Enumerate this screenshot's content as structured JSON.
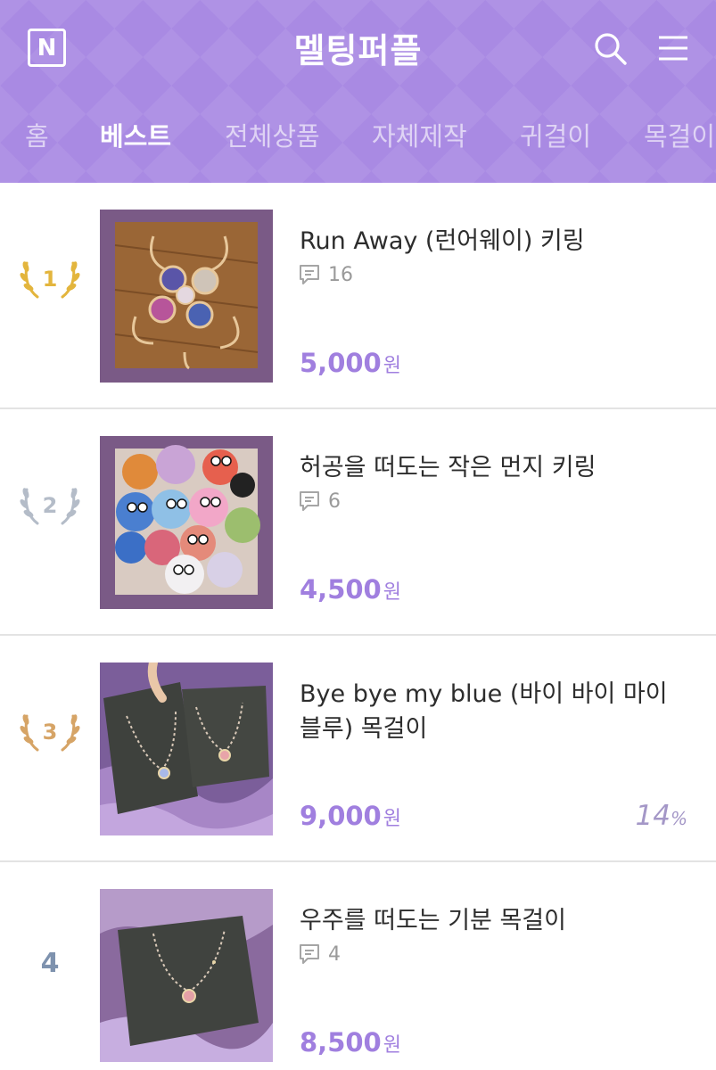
{
  "header": {
    "logo_letter": "N",
    "title": "멜팅퍼플"
  },
  "tabs": [
    "홈",
    "베스트",
    "전체상품",
    "자체제작",
    "귀걸이",
    "목걸이"
  ],
  "active_tab": "베스트",
  "colors": {
    "header_bg": "#a98ae3",
    "price": "#a07fdf",
    "gold": "#e3b53d",
    "silver": "#b4bcc8",
    "bronze": "#d6a466",
    "rank_plain": "#7e92ae"
  },
  "products": [
    {
      "rank": "1",
      "name": "Run Away (런어웨이) 키링",
      "comments": "16",
      "price": "5,000",
      "currency": "원",
      "discount": ""
    },
    {
      "rank": "2",
      "name": "허공을 떠도는 작은 먼지 키링",
      "comments": "6",
      "price": "4,500",
      "currency": "원",
      "discount": ""
    },
    {
      "rank": "3",
      "name": "Bye bye my blue (바이 바이 마이 블루) 목걸이",
      "comments": "",
      "price": "9,000",
      "currency": "원",
      "discount": "14",
      "discount_unit": "%"
    },
    {
      "rank": "4",
      "name": "우주를 떠도는 기분 목걸이",
      "comments": "4",
      "price": "8,500",
      "currency": "원",
      "discount": ""
    }
  ]
}
